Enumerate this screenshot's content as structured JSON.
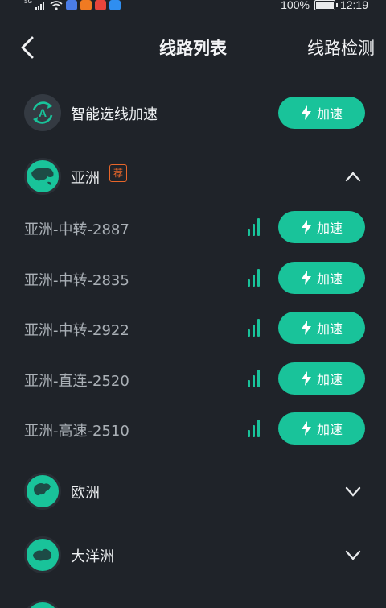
{
  "status_bar": {
    "battery_pct": "100%",
    "time": "12:19",
    "battery_level": 1.0,
    "network": "5G"
  },
  "header": {
    "title": "线路列表",
    "right_action": "线路检测"
  },
  "smart": {
    "label": "智能选线加速",
    "button": "加速"
  },
  "regions": [
    {
      "name": "亚洲",
      "badge": "荐",
      "expanded": true
    },
    {
      "name": "欧洲",
      "expanded": false
    },
    {
      "name": "大洋洲",
      "expanded": false
    }
  ],
  "lines": [
    {
      "name": "亚洲-中转-2887",
      "button": "加速",
      "signal_bars": 3
    },
    {
      "name": "亚洲-中转-2835",
      "button": "加速",
      "signal_bars": 3
    },
    {
      "name": "亚洲-中转-2922",
      "button": "加速",
      "signal_bars": 3
    },
    {
      "name": "亚洲-直连-2520",
      "button": "加速",
      "signal_bars": 3
    },
    {
      "name": "亚洲-高速-2510",
      "button": "加速",
      "signal_bars": 3
    }
  ],
  "colors": {
    "accent": "#19c39a",
    "background": "#1f2329",
    "badge": "#e8662a",
    "line_text": "#aab0b6"
  }
}
